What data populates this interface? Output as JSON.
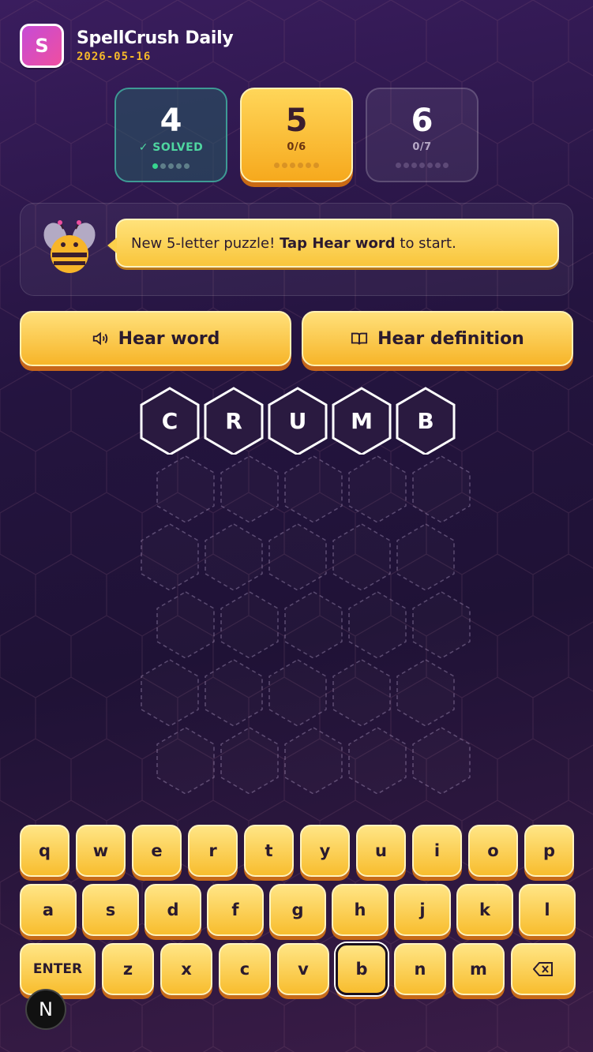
{
  "app": {
    "logo_letter": "S",
    "title": "SpellCrush Daily",
    "date": "2026-05-16"
  },
  "levels": [
    {
      "number": "4",
      "status": "✓ SOLVED",
      "dots_total": 5,
      "dots_done": 1,
      "state": "solved"
    },
    {
      "number": "5",
      "status": "0/6",
      "dots_total": 6,
      "dots_done": 0,
      "state": "active"
    },
    {
      "number": "6",
      "status": "0/7",
      "dots_total": 7,
      "dots_done": 0,
      "state": "locked"
    }
  ],
  "message": {
    "prefix": "New 5-letter puzzle! ",
    "bold": "Tap Hear word",
    "suffix": " to start."
  },
  "actions": {
    "hear_word": "Hear word",
    "hear_definition": "Hear definition"
  },
  "guess_letters": [
    "C",
    "R",
    "U",
    "M",
    "B"
  ],
  "empty_rows": 5,
  "keyboard": {
    "row1": [
      "q",
      "w",
      "e",
      "r",
      "t",
      "y",
      "u",
      "i",
      "o",
      "p"
    ],
    "row2": [
      "a",
      "s",
      "d",
      "f",
      "g",
      "h",
      "j",
      "k",
      "l"
    ],
    "row3": [
      "ENTER",
      "z",
      "x",
      "c",
      "v",
      "b",
      "n",
      "m",
      "⌫"
    ],
    "pressed_key": "b"
  },
  "badge": "N",
  "colors": {
    "accent": "#f8bd2e",
    "solved": "#4fd6a0",
    "background": "#24143f"
  }
}
